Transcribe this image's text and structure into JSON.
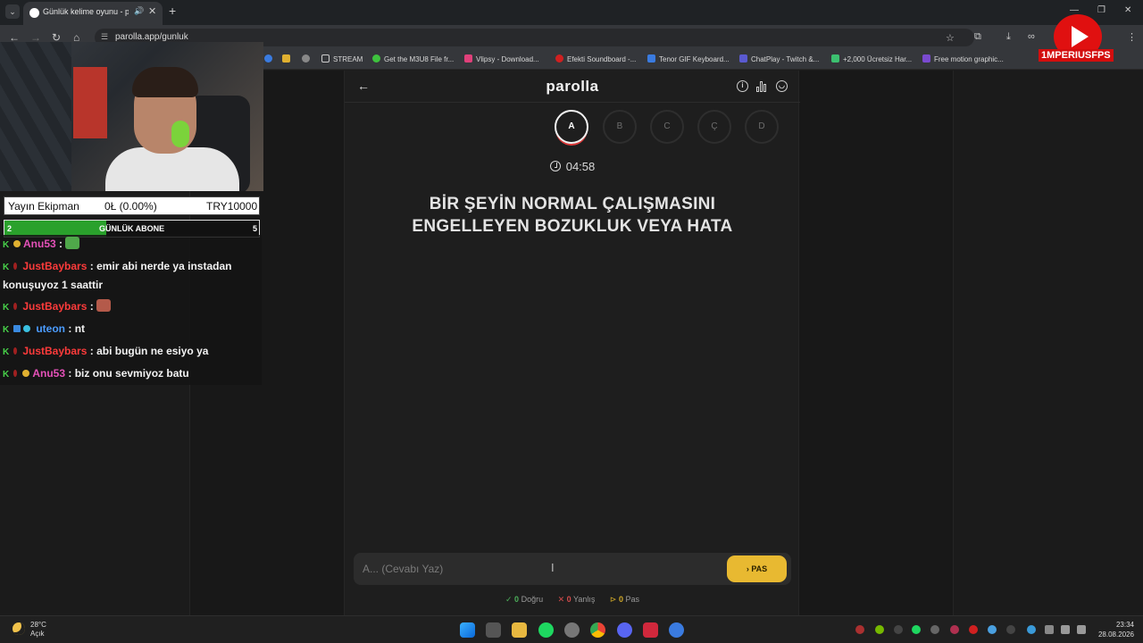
{
  "browser": {
    "tab_title": "Günlük kelime oyunu - parolla",
    "url": "parolla.app/gunluk",
    "bookmarks": [
      {
        "label": "STREAM",
        "color": "#cccccc"
      },
      {
        "label": "Get the M3U8 File fr...",
        "color": "#3ec23e"
      },
      {
        "label": "Vlipsy - Download...",
        "color": "#e0407a"
      },
      {
        "label": "Efekti Soundboard -...",
        "color": "#d02020"
      },
      {
        "label": "Tenor GIF Keyboard...",
        "color": "#3a7be0"
      },
      {
        "label": "ChatPlay - Twitch &...",
        "color": "#5a5ad0"
      },
      {
        "label": "+2,000 Ücretsiz Har...",
        "color": "#3cc070"
      },
      {
        "label": "Free motion graphic...",
        "color": "#7a4ad0"
      }
    ]
  },
  "overlay": {
    "channel_name": "1MPERIUSFPS",
    "ekip_label": "Yayın Ekipman",
    "ekip_progress": "0Ł (0.00%)",
    "ekip_goal": "TRY10000",
    "abone_current": "2",
    "abone_label": "GÜNLÜK ABONE",
    "abone_goal": "5",
    "abone_progress_fraction": 0.4
  },
  "chat": [
    {
      "user": "Anu53",
      "sep": " :",
      "text": "",
      "color": "pink"
    },
    {
      "user": "JustBaybars",
      "sep": " :",
      "text": " emir abi nerde ya instadan",
      "color": "red"
    },
    {
      "user": "",
      "sep": "",
      "text": "konuşuyoz 1 saattir",
      "color": "none"
    },
    {
      "user": "JustBaybars",
      "sep": " :",
      "text": "",
      "color": "red"
    },
    {
      "user": "uteon",
      "sep": " :",
      "text": " nt",
      "color": "blue"
    },
    {
      "user": "JustBaybars",
      "sep": " :",
      "text": " abi bugün ne esiyo ya",
      "color": "red"
    },
    {
      "user": "Anu53",
      "sep": " :",
      "text": " biz onu sevmiyoz batu",
      "color": "pink"
    }
  ],
  "app": {
    "logo": "parolla",
    "letters": [
      "A",
      "B",
      "C",
      "Ç",
      "D"
    ],
    "active_letter": "A",
    "timer": "04:58",
    "question_line1": "BİR ŞEYİN NORMAL ÇALIŞMASINI",
    "question_line2": "ENGELLEYEN BOZUKLUK VEYA HATA",
    "answer_placeholder": "A... (Cevabı Yaz)",
    "pas_label": "PAS",
    "stats": {
      "correct_count": "0",
      "correct_label": "Doğru",
      "wrong_count": "0",
      "wrong_label": "Yanlış",
      "pass_count": "0",
      "pass_label": "Pas"
    }
  },
  "taskbar": {
    "temperature": "28°C",
    "weather": "Açık",
    "time": "23:34",
    "date": "28.08.2026"
  }
}
